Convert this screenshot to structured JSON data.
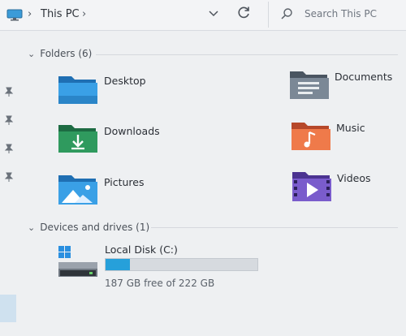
{
  "addressbar": {
    "location": "This PC"
  },
  "search": {
    "placeholder": "Search This PC"
  },
  "folders": {
    "header": "Folders (6)",
    "items": [
      {
        "name": "Desktop",
        "icon": "desktop-folder-icon",
        "color": "#2f8fd8"
      },
      {
        "name": "Documents",
        "icon": "documents-folder-icon",
        "color": "#6f7c8a"
      },
      {
        "name": "Downloads",
        "icon": "downloads-folder-icon",
        "color": "#2e8b57"
      },
      {
        "name": "Music",
        "icon": "music-folder-icon",
        "color": "#e26a3b"
      },
      {
        "name": "Pictures",
        "icon": "pictures-folder-icon",
        "color": "#2f8fd8"
      },
      {
        "name": "Videos",
        "icon": "videos-folder-icon",
        "color": "#6a4fb6"
      }
    ]
  },
  "drives": {
    "header": "Devices and drives (1)",
    "items": [
      {
        "name": "Local Disk (C:)",
        "free_text": "187 GB free of 222 GB",
        "used_fraction": 0.158,
        "bar_color": "#26a0da"
      }
    ]
  }
}
